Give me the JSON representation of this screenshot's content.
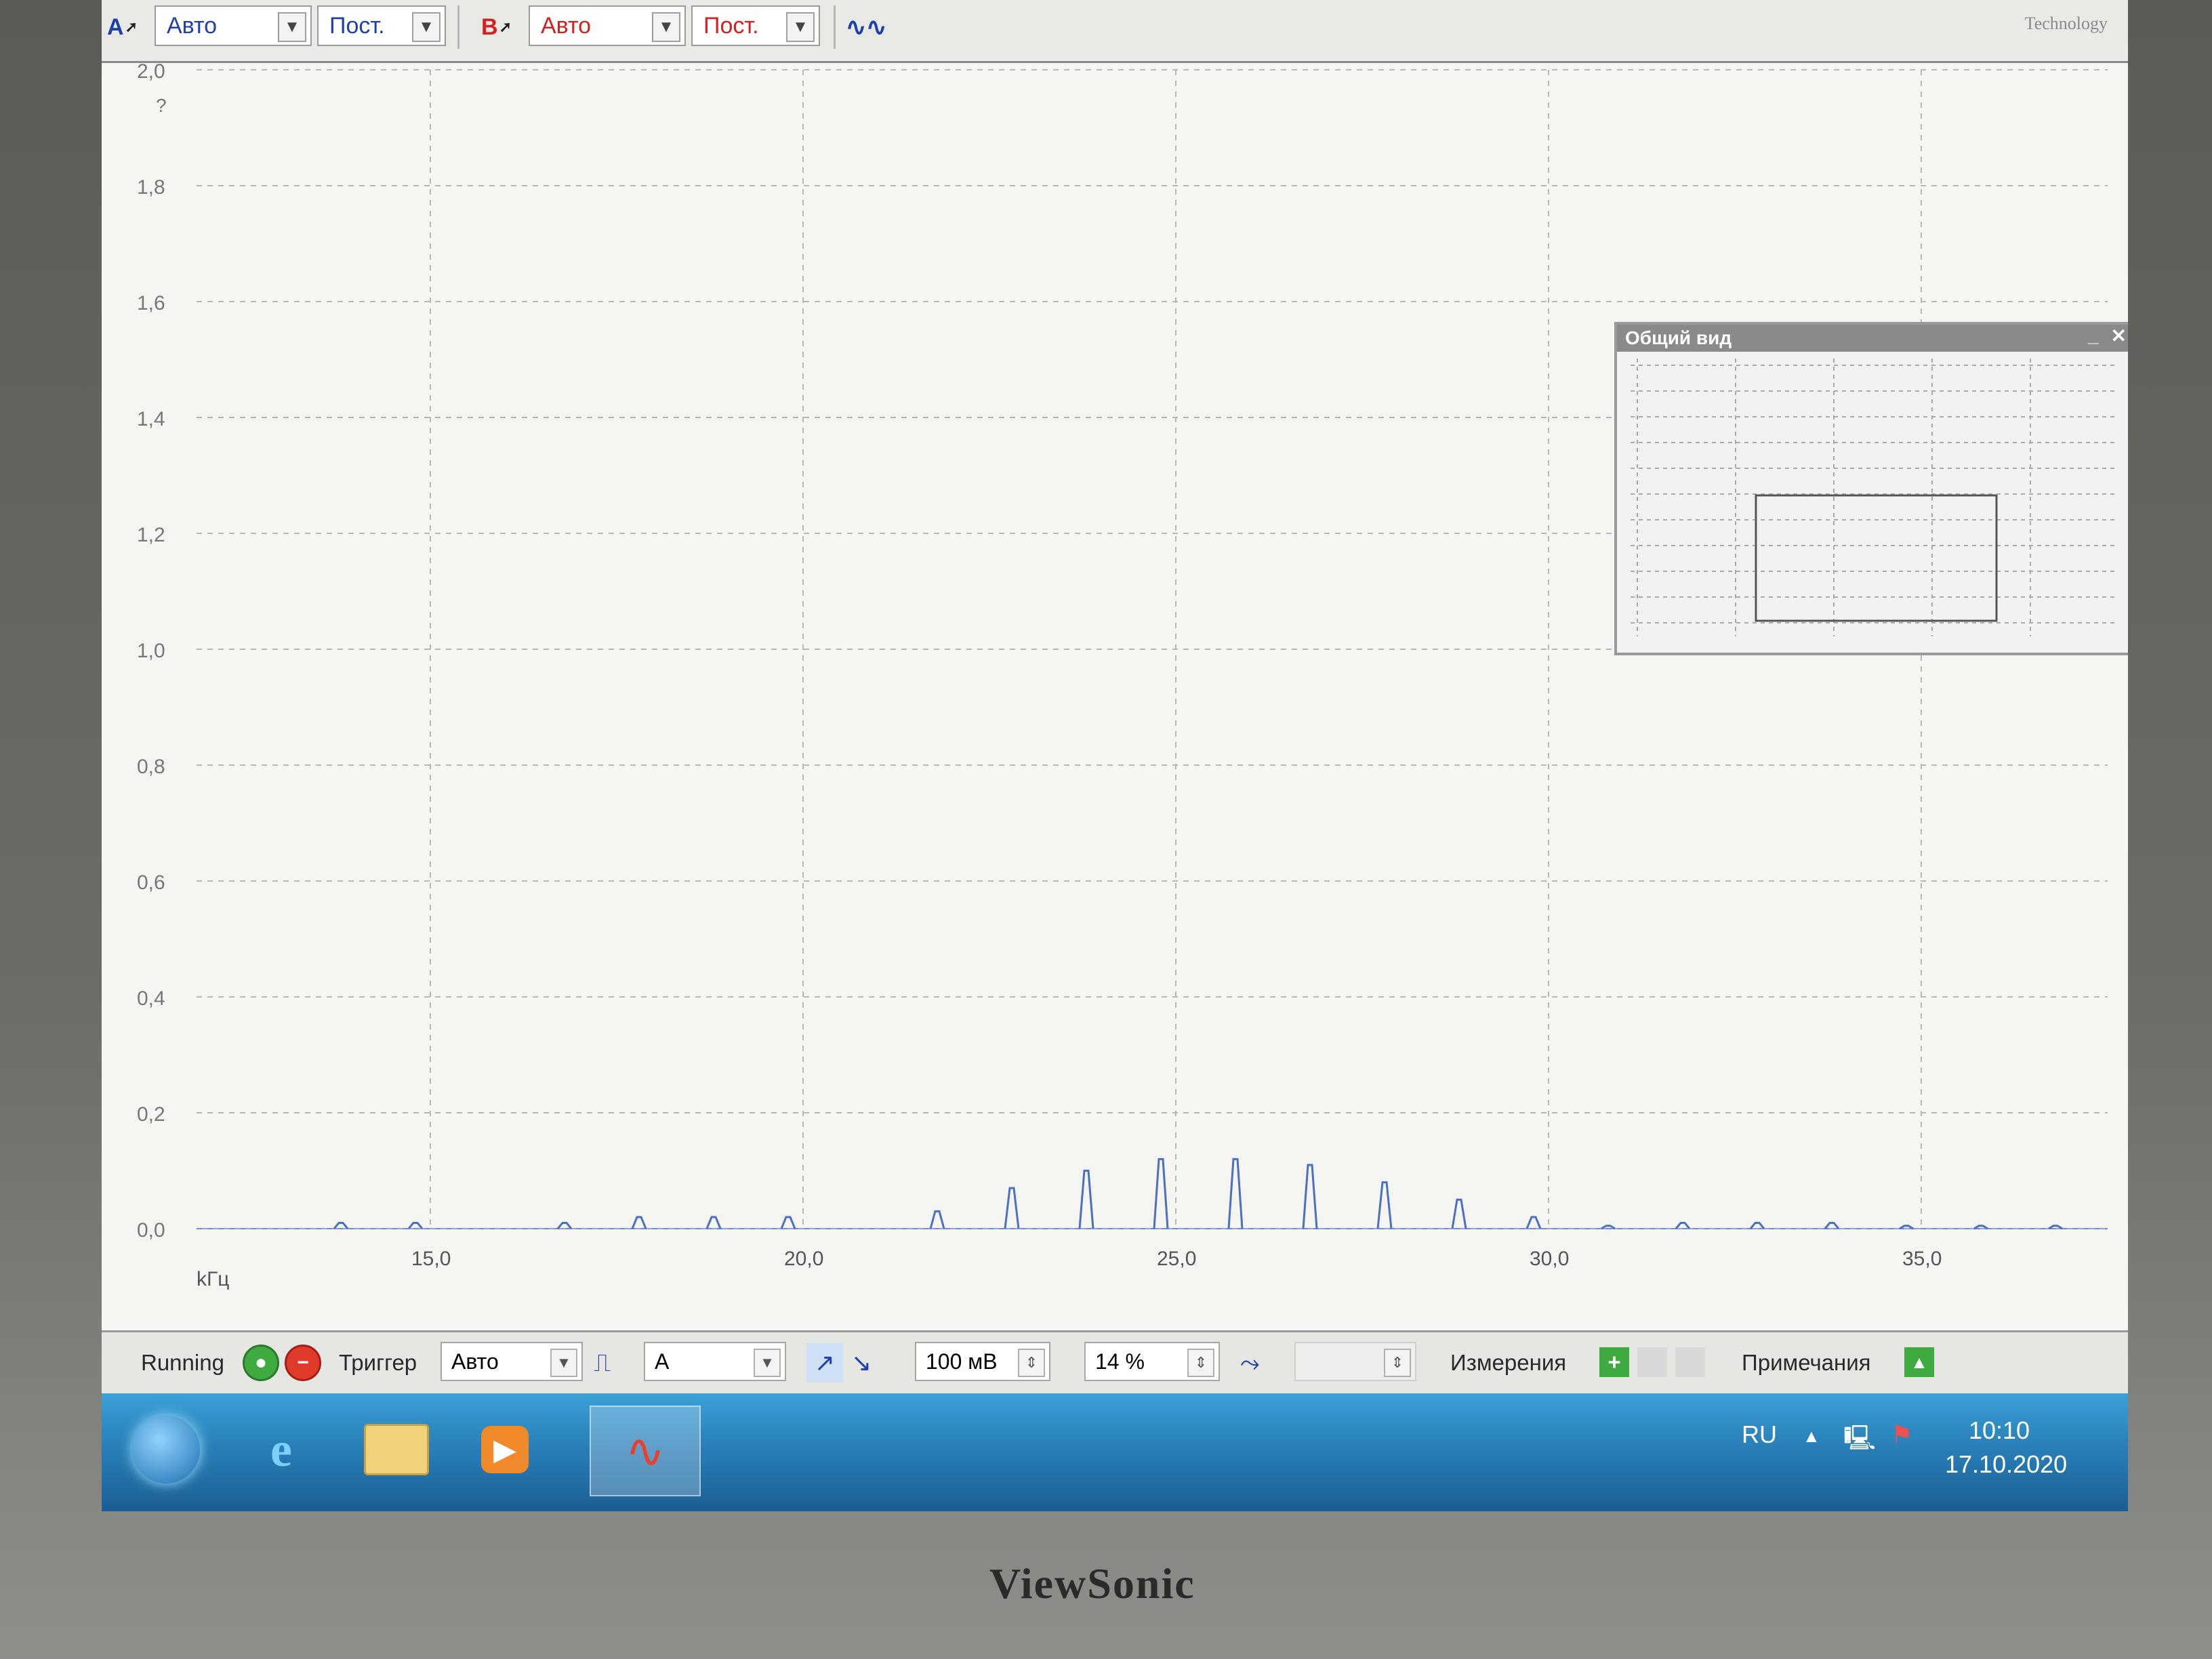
{
  "toolbar": {
    "ch_a_label": "A",
    "ch_a_range": "Авто",
    "ch_a_coupling": "Пост.",
    "ch_b_label": "B",
    "ch_b_range": "Авто",
    "ch_b_coupling": "Пост.",
    "logo_text": "Technology"
  },
  "overview": {
    "title": "Общий вид",
    "minimize": "_",
    "close": "✕"
  },
  "bottombar": {
    "status": "Running",
    "trigger_label": "Триггер",
    "trigger_mode": "Авто",
    "trigger_channel": "A",
    "threshold": "100 мВ",
    "pre_trigger": "14 %",
    "measurements_label": "Измерения",
    "notes_label": "Примечания"
  },
  "taskbar": {
    "language": "RU",
    "time": "10:10",
    "date": "17.10.2020"
  },
  "monitor": {
    "brand": "ViewSonic"
  },
  "colors": {
    "trace": "#4a6fc4",
    "grid": "#b8b8b8",
    "channel_a": "#1f3fb0",
    "channel_b": "#d42020"
  },
  "chart_data": {
    "type": "line",
    "xlabel": "kГц",
    "ylabel": "",
    "y_unit_marker": "?",
    "xlim": [
      11.5,
      37.5
    ],
    "ylim": [
      0,
      2.0
    ],
    "yticks": [
      "0,0",
      "0,2",
      "0,4",
      "0,6",
      "0,8",
      "1,0",
      "1,2",
      "1,4",
      "1,6",
      "1,8",
      "2,0"
    ],
    "xticks": [
      "15,0",
      "20,0",
      "25,0",
      "30,0",
      "35,0"
    ],
    "xtick_values": [
      15,
      20,
      25,
      30,
      35
    ],
    "grid": true,
    "series": [
      {
        "peak_freqs": [
          13.8,
          14.8,
          16.8,
          17.8,
          18.8,
          19.8,
          21.8,
          22.8,
          23.8,
          24.8,
          25.8,
          26.8,
          27.8,
          28.8,
          29.8,
          30.8,
          31.8,
          32.8,
          33.8,
          34.8,
          35.8,
          36.8
        ],
        "peak_values": [
          0.01,
          0.01,
          0.01,
          0.02,
          0.02,
          0.02,
          0.03,
          0.07,
          0.1,
          0.12,
          0.12,
          0.11,
          0.08,
          0.05,
          0.02,
          0.005,
          0.01,
          0.01,
          0.01,
          0.005,
          0.005,
          0.005
        ]
      }
    ]
  }
}
